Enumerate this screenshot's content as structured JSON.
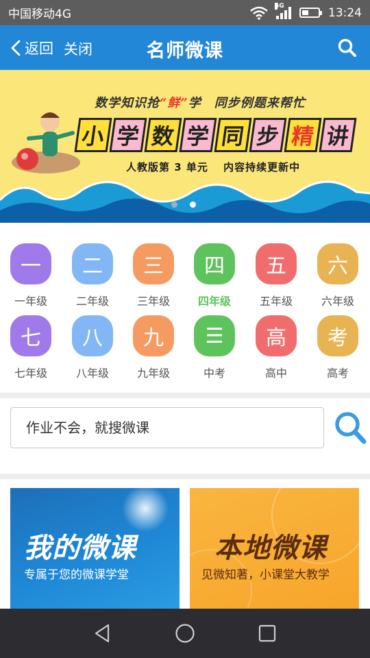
{
  "status_bar": {
    "carrier": "中国移动4G",
    "network_badge": "4G",
    "time": "13:24",
    "icons": [
      "wifi-icon",
      "signal-icon",
      "battery-icon"
    ]
  },
  "header": {
    "back_label": "返回",
    "close_label": "关闭",
    "title": "名师微课",
    "search_icon": "search-icon",
    "color": "#2387d8"
  },
  "banner": {
    "slogan_left": "数学知识抢",
    "slogan_fresh": "“鲜”",
    "slogan_right": "学　同步例题来帮忙",
    "headline": [
      "小",
      "学",
      "数",
      "学",
      "同",
      "步",
      "精",
      "讲"
    ],
    "subtitle": "人教版第 3 单元　 内容持续更新中",
    "slides_total": 2,
    "active_slide": 2
  },
  "grades": [
    {
      "icon_char": "一",
      "label": "一年级",
      "color": "#a079ea",
      "active": false
    },
    {
      "icon_char": "二",
      "label": "二年级",
      "color": "#82b6f5",
      "active": false
    },
    {
      "icon_char": "三",
      "label": "三年级",
      "color": "#f59b62",
      "active": false
    },
    {
      "icon_char": "四",
      "label": "四年级",
      "color": "#5fc35d",
      "active": true
    },
    {
      "icon_char": "五",
      "label": "五年级",
      "color": "#f16d6d",
      "active": false
    },
    {
      "icon_char": "六",
      "label": "六年级",
      "color": "#e8b352",
      "active": false
    },
    {
      "icon_char": "七",
      "label": "七年级",
      "color": "#a079ea",
      "active": false
    },
    {
      "icon_char": "八",
      "label": "八年级",
      "color": "#82b6f5",
      "active": false
    },
    {
      "icon_char": "九",
      "label": "九年级",
      "color": "#f59b62",
      "active": false
    },
    {
      "icon_char": "☰",
      "label": "中考",
      "color": "#5fc35d",
      "active": false
    },
    {
      "icon_char": "高",
      "label": "高中",
      "color": "#f16d6d",
      "active": false
    },
    {
      "icon_char": "考",
      "label": "高考",
      "color": "#e8b352",
      "active": false
    }
  ],
  "search": {
    "placeholder": "作业不会，就搜微课"
  },
  "cards": {
    "my": {
      "title": "我的微课",
      "subtitle": "专属于您的微课学堂"
    },
    "local": {
      "title": "本地微课",
      "subtitle": "见微知著，小课堂大教学"
    }
  },
  "nav": {
    "icons": [
      "back-triangle-icon",
      "home-circle-icon",
      "recents-square-icon"
    ]
  }
}
